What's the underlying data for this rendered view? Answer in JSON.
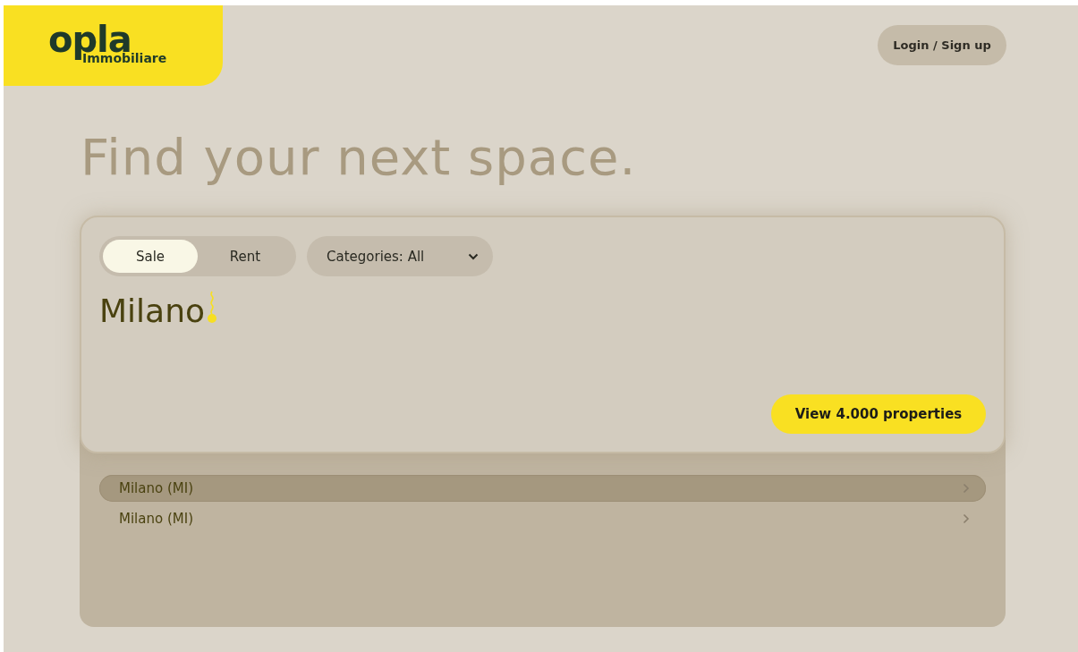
{
  "logo": {
    "wordmark": "opla",
    "tagline": "Immobiliare"
  },
  "header": {
    "login_button": "Login / Sign up"
  },
  "headline": "Find your next space.",
  "search": {
    "mode_tabs": [
      {
        "label": "Sale",
        "selected": true
      },
      {
        "label": "Rent",
        "selected": false
      }
    ],
    "category_dropdown": {
      "label": "Categories: All"
    },
    "query": "Milano",
    "submit_button": "View 4.000 properties"
  },
  "suggestions": [
    {
      "label": "Milano (MI)",
      "selected": true
    },
    {
      "label": "Milano (MI)",
      "selected": false
    }
  ]
}
